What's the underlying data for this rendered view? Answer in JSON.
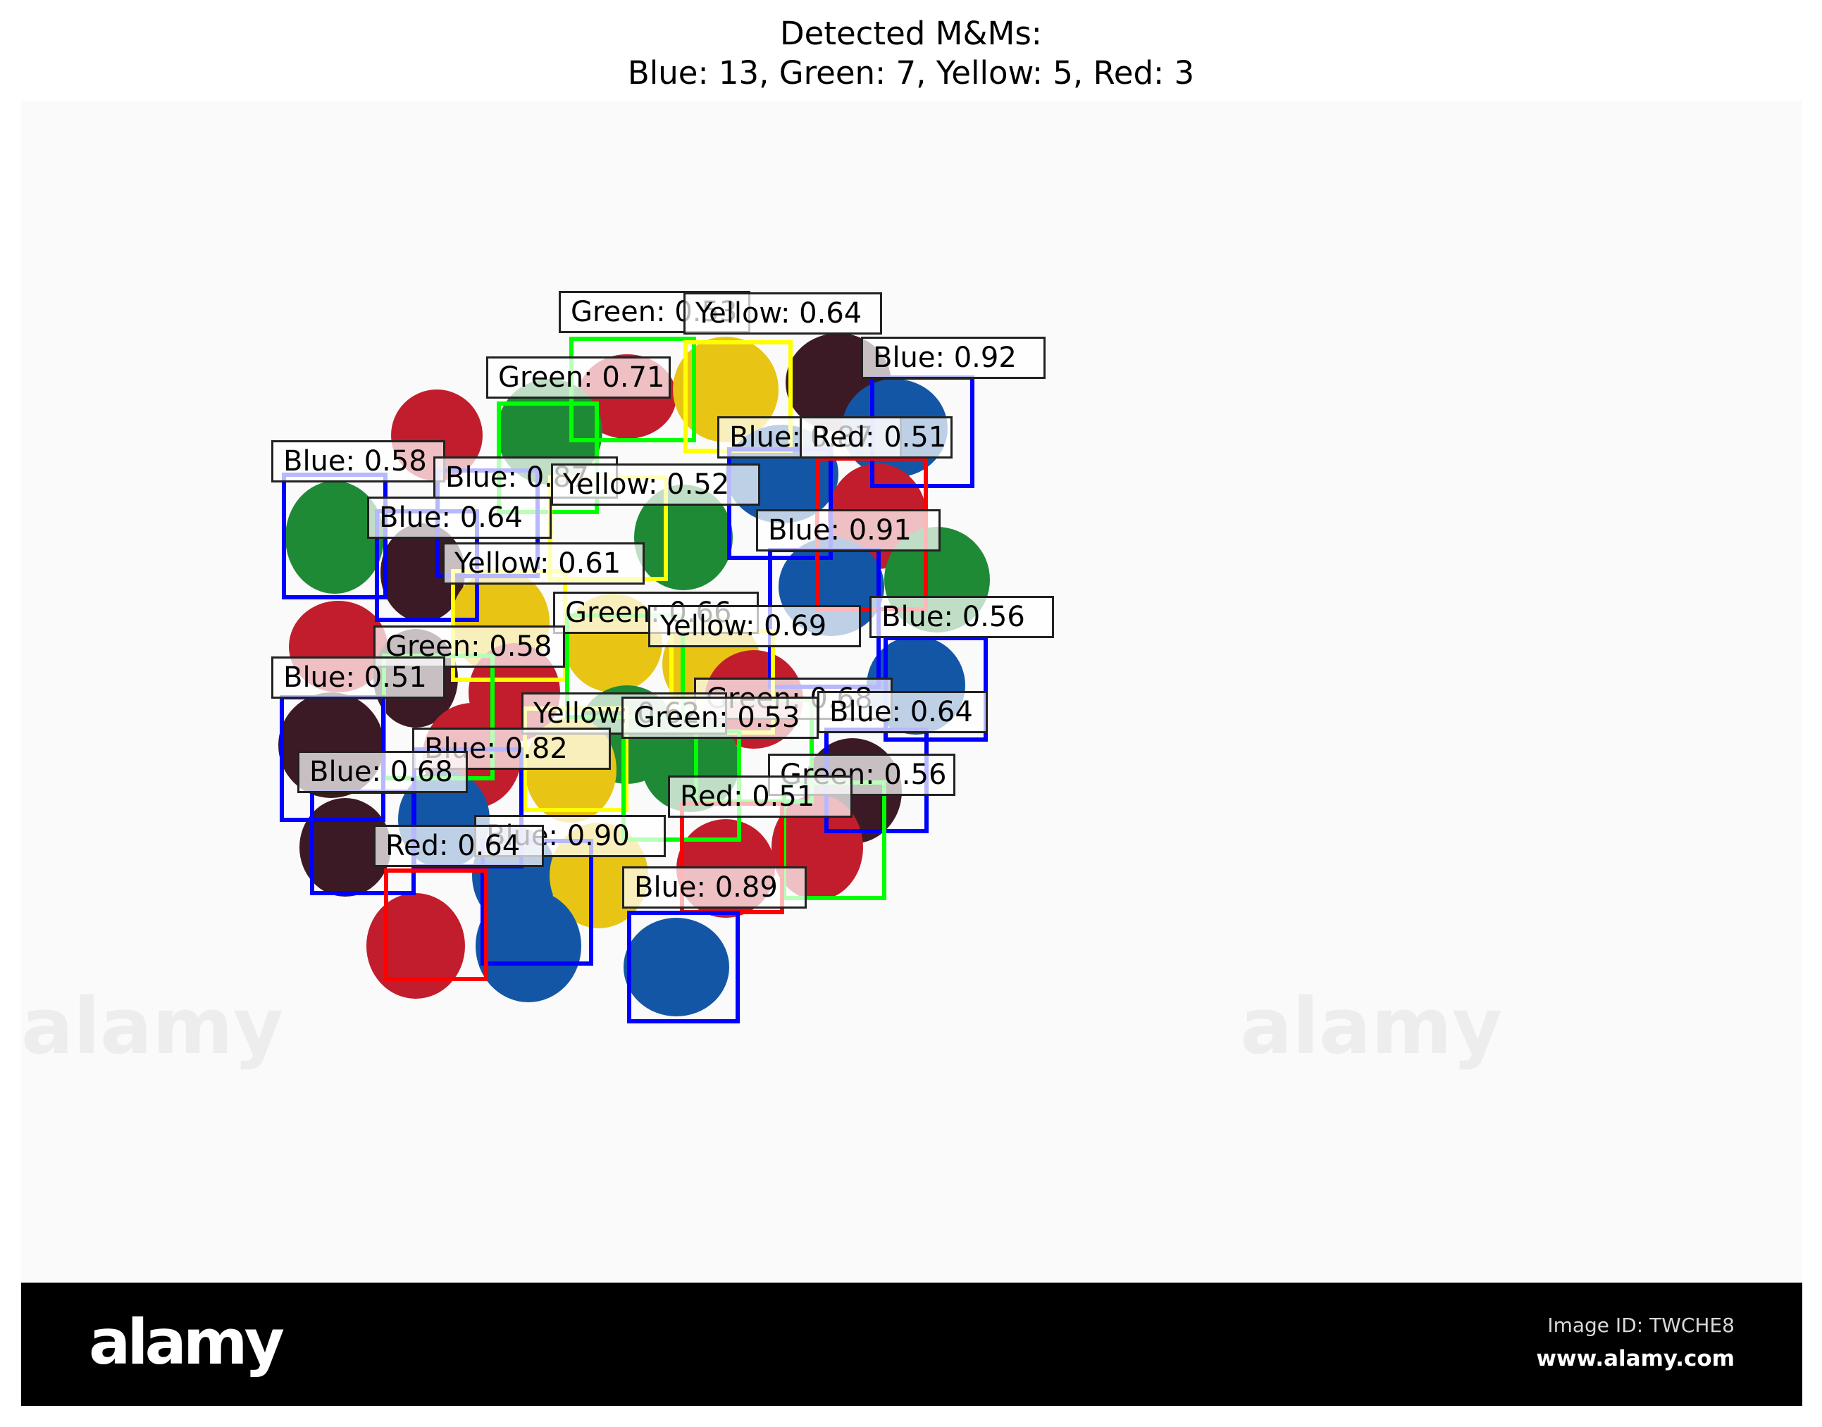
{
  "title": {
    "line1": "Detected M&Ms:",
    "line2": "Blue: 13, Green: 7, Yellow: 5, Red: 3"
  },
  "colors": {
    "Blue": "#0000ff",
    "Green": "#00ff00",
    "Yellow": "#ffff00",
    "Red": "#ff0000",
    "footer_bg": "#000000",
    "background": "#fafafa"
  },
  "counts": {
    "Blue": 13,
    "Green": 7,
    "Yellow": 5,
    "Red": 3
  },
  "detections": [
    {
      "label": "Green: 0.53",
      "cls": "Green",
      "score": 0.53
    },
    {
      "label": "Yellow: 0.64",
      "cls": "Yellow",
      "score": 0.64
    },
    {
      "label": "Blue: 0.92",
      "cls": "Blue",
      "score": 0.92
    },
    {
      "label": "Green: 0.71",
      "cls": "Green",
      "score": 0.71
    },
    {
      "label": "Blue: 0.87",
      "cls": "Blue",
      "score": 0.87
    },
    {
      "label": "Red: 0.51",
      "cls": "Red",
      "score": 0.51
    },
    {
      "label": "Blue: 0.58",
      "cls": "Blue",
      "score": 0.58
    },
    {
      "label": "Blue: 0.87",
      "cls": "Blue",
      "score": 0.87
    },
    {
      "label": "Yellow: 0.52",
      "cls": "Yellow",
      "score": 0.52
    },
    {
      "label": "Blue: 0.64",
      "cls": "Blue",
      "score": 0.64
    },
    {
      "label": "Blue: 0.91",
      "cls": "Blue",
      "score": 0.91
    },
    {
      "label": "Yellow: 0.61",
      "cls": "Yellow",
      "score": 0.61
    },
    {
      "label": "Green: 0.66",
      "cls": "Green",
      "score": 0.66
    },
    {
      "label": "Yellow: 0.69",
      "cls": "Yellow",
      "score": 0.69
    },
    {
      "label": "Blue: 0.56",
      "cls": "Blue",
      "score": 0.56
    },
    {
      "label": "Green: 0.58",
      "cls": "Green",
      "score": 0.58
    },
    {
      "label": "Blue: 0.51",
      "cls": "Blue",
      "score": 0.51
    },
    {
      "label": "Green: 0.68",
      "cls": "Green",
      "score": 0.68
    },
    {
      "label": "Yellow: 0.62",
      "cls": "Yellow",
      "score": 0.62
    },
    {
      "label": "Green: 0.53",
      "cls": "Green",
      "score": 0.53
    },
    {
      "label": "Blue: 0.64",
      "cls": "Blue",
      "score": 0.64
    },
    {
      "label": "Blue: 0.82",
      "cls": "Blue",
      "score": 0.82
    },
    {
      "label": "Blue: 0.68",
      "cls": "Blue",
      "score": 0.68
    },
    {
      "label": "Green: 0.56",
      "cls": "Green",
      "score": 0.56
    },
    {
      "label": "Red: 0.51",
      "cls": "Red",
      "score": 0.51
    },
    {
      "label": "Blue: 0.90",
      "cls": "Blue",
      "score": 0.9
    },
    {
      "label": "Red: 0.64",
      "cls": "Red",
      "score": 0.64
    },
    {
      "label": "Blue: 0.89",
      "cls": "Blue",
      "score": 0.89
    }
  ],
  "footer": {
    "logo": "alamy",
    "image_id": "Image ID: TWCHE8",
    "url": "www.alamy.com"
  },
  "watermark": "alamy"
}
